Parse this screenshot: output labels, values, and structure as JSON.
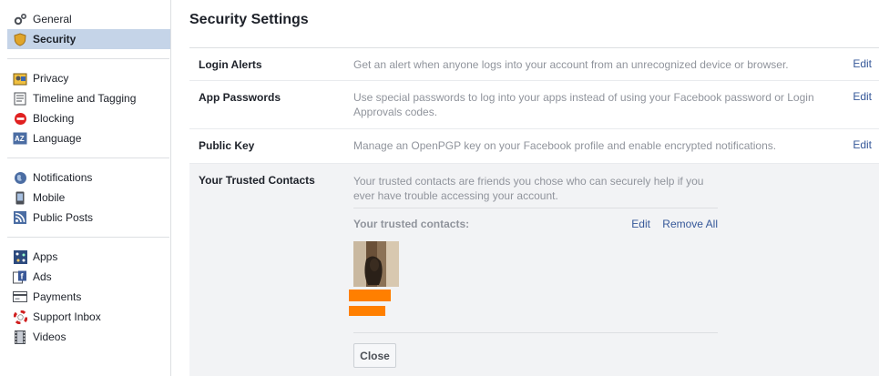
{
  "sidebar": {
    "groups": [
      {
        "items": [
          {
            "label": "General",
            "icon": "gear-icon"
          },
          {
            "label": "Security",
            "icon": "shield-icon",
            "active": true
          }
        ]
      },
      {
        "items": [
          {
            "label": "Privacy",
            "icon": "lock-icon"
          },
          {
            "label": "Timeline and Tagging",
            "icon": "timeline-icon"
          },
          {
            "label": "Blocking",
            "icon": "block-icon"
          },
          {
            "label": "Language",
            "icon": "language-icon"
          }
        ]
      },
      {
        "items": [
          {
            "label": "Notifications",
            "icon": "globe-icon"
          },
          {
            "label": "Mobile",
            "icon": "mobile-icon"
          },
          {
            "label": "Public Posts",
            "icon": "rss-icon"
          }
        ]
      },
      {
        "items": [
          {
            "label": "Apps",
            "icon": "apps-icon"
          },
          {
            "label": "Ads",
            "icon": "ads-icon"
          },
          {
            "label": "Payments",
            "icon": "credit-card-icon"
          },
          {
            "label": "Support Inbox",
            "icon": "lifebuoy-icon"
          },
          {
            "label": "Videos",
            "icon": "film-icon"
          }
        ]
      }
    ]
  },
  "main": {
    "title": "Security Settings",
    "rows": [
      {
        "name": "Login Alerts",
        "description": "Get an alert when anyone logs into your account from an unrecognized device or browser.",
        "edit": "Edit"
      },
      {
        "name": "App Passwords",
        "description": "Use special passwords to log into your apps instead of using your Facebook password or Login Approvals codes.",
        "edit": "Edit"
      },
      {
        "name": "Public Key",
        "description": "Manage an OpenPGP key on your Facebook profile and enable encrypted notifications.",
        "edit": "Edit"
      }
    ],
    "trusted": {
      "name": "Your Trusted Contacts",
      "description": "Your trusted contacts are friends you chose who can securely help if you ever have trouble accessing your account.",
      "list_label": "Your trusted contacts:",
      "edit": "Edit",
      "remove_all": "Remove All",
      "close": "Close"
    }
  },
  "colors": {
    "link": "#365899",
    "active_bg": "#c5d4e8",
    "panel_bg": "#f2f3f5",
    "redaction": "#ff7f00"
  }
}
